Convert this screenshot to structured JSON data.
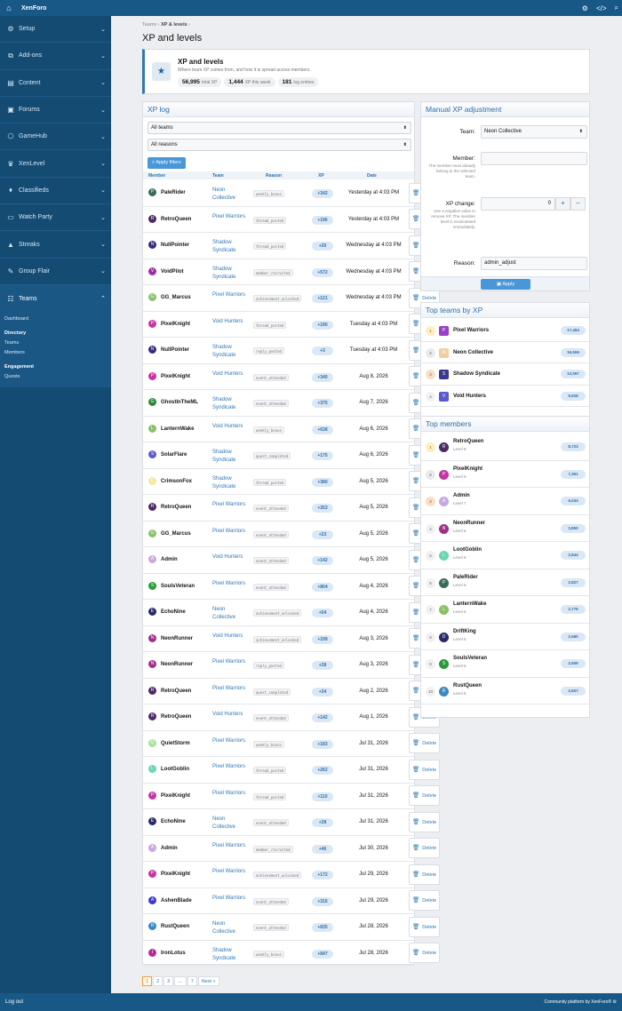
{
  "app": {
    "title": "XenForo",
    "cogs_icon": "cogs-icon",
    "code_icon": "code-icon",
    "search_icon": "search-icon"
  },
  "sidebar": {
    "items": [
      {
        "label": "Setup",
        "icon": "⚙"
      },
      {
        "label": "Add-ons",
        "icon": "⧉"
      },
      {
        "label": "Content",
        "icon": "▤"
      },
      {
        "label": "Forums",
        "icon": "▣"
      },
      {
        "label": "GameHub",
        "icon": "⎔"
      },
      {
        "label": "XenLevel",
        "icon": "♛"
      },
      {
        "label": "Classifieds",
        "icon": "⬧"
      },
      {
        "label": "Watch Party",
        "icon": "▭"
      },
      {
        "label": "Streaks",
        "icon": "▲"
      },
      {
        "label": "Group Flair",
        "icon": "✎"
      },
      {
        "label": "Teams",
        "icon": "☷"
      }
    ],
    "sub": {
      "dashboard": "Dashboard",
      "directory": "Directory",
      "teams": "Teams",
      "members": "Members",
      "engagement": "Engagement",
      "quests": "Quests"
    }
  },
  "breadcrumb": {
    "root": "Teams",
    "current": "XP & levels"
  },
  "page_title": "XP and levels",
  "hero": {
    "title": "XP and levels",
    "subtitle": "Where team XP comes from, and how it is spread across members.",
    "total_xp": "56,995",
    "total_xp_label": "total XP",
    "week_xp": "1,444",
    "week_label": "XP this week",
    "entries": "181",
    "entries_label": "log entries"
  },
  "xplog": {
    "title": "XP log",
    "team_filter": "All teams",
    "reason_filter": "All reasons",
    "apply_label": "Apply filters",
    "cols": {
      "member": "Member",
      "team": "Team",
      "reason": "Reason",
      "xp": "XP",
      "date": "Date"
    },
    "rows": [
      {
        "init": "P",
        "color": "#3a6b5c",
        "member": "PaleRider",
        "team": "Neon Collective",
        "reason": "weekly_bonus",
        "xp": "+342",
        "date": "Yesterday at 4:03 PM"
      },
      {
        "init": "R",
        "color": "#4b2a66",
        "member": "RetroQueen",
        "team": "Pixel Warriors",
        "reason": "thread_posted",
        "xp": "+196",
        "date": "Yesterday at 4:03 PM"
      },
      {
        "init": "N",
        "color": "#3a2a7a",
        "member": "NullPointer",
        "team": "Shadow Syndicate",
        "reason": "thread_posted",
        "xp": "+20",
        "date": "Wednesday at 4:03 PM"
      },
      {
        "init": "V",
        "color": "#9b2fa5",
        "member": "VoidPilot",
        "team": "Shadow Syndicate",
        "reason": "member_recruited",
        "xp": "+572",
        "date": "Wednesday at 4:03 PM"
      },
      {
        "init": "G",
        "color": "#8dc06a",
        "member": "GG_Marcus",
        "team": "Pixel Warriors",
        "reason": "achievement_unlocked",
        "xp": "+121",
        "date": "Wednesday at 4:03 PM"
      },
      {
        "init": "P",
        "color": "#c534a0",
        "member": "PixelKnight",
        "team": "Void Hunters",
        "reason": "thread_posted",
        "xp": "+190",
        "date": "Tuesday at 4:03 PM"
      },
      {
        "init": "N",
        "color": "#3a2a7a",
        "member": "NullPointer",
        "team": "Shadow Syndicate",
        "reason": "reply_posted",
        "xp": "+3",
        "date": "Tuesday at 4:03 PM"
      },
      {
        "init": "P",
        "color": "#c534a0",
        "member": "PixelKnight",
        "team": "Void Hunters",
        "reason": "event_attended",
        "xp": "+340",
        "date": "Aug 8, 2026"
      },
      {
        "init": "G",
        "color": "#2a8a3a",
        "member": "GhostInTheML",
        "team": "Shadow Syndicate",
        "reason": "event_attended",
        "xp": "+375",
        "date": "Aug 7, 2026"
      },
      {
        "init": "L",
        "color": "#8dc06a",
        "member": "LanternWake",
        "team": "Void Hunters",
        "reason": "weekly_bonus",
        "xp": "+638",
        "date": "Aug 6, 2026"
      },
      {
        "init": "S",
        "color": "#5a5ad0",
        "member": "SolarFlare",
        "team": "Shadow Syndicate",
        "reason": "quest_completed",
        "xp": "+175",
        "date": "Aug 6, 2026"
      },
      {
        "init": "C",
        "color": "#f4e79e",
        "member": "CrimsonFox",
        "team": "Shadow Syndicate",
        "reason": "thread_posted",
        "xp": "+380",
        "date": "Aug 5, 2026"
      },
      {
        "init": "R",
        "color": "#4b2a66",
        "member": "RetroQueen",
        "team": "Pixel Warriors",
        "reason": "event_attended",
        "xp": "+353",
        "date": "Aug 5, 2026"
      },
      {
        "init": "G",
        "color": "#8dc06a",
        "member": "GG_Marcus",
        "team": "Pixel Warriors",
        "reason": "event_attended",
        "xp": "+23",
        "date": "Aug 5, 2026"
      },
      {
        "init": "A",
        "color": "#c7a8e2",
        "member": "Admin",
        "team": "Void Hunters",
        "reason": "event_attended",
        "xp": "+142",
        "date": "Aug 5, 2026"
      },
      {
        "init": "S",
        "color": "#2a9a3a",
        "member": "SoulsVeteran",
        "team": "Pixel Warriors",
        "reason": "event_attended",
        "xp": "+804",
        "date": "Aug 4, 2026"
      },
      {
        "init": "E",
        "color": "#2a2a6a",
        "member": "EchoNine",
        "team": "Neon Collective",
        "reason": "achievement_unlocked",
        "xp": "+54",
        "date": "Aug 4, 2026"
      },
      {
        "init": "N",
        "color": "#a0308a",
        "member": "NeonRunner",
        "team": "Void Hunters",
        "reason": "achievement_unlocked",
        "xp": "+199",
        "date": "Aug 3, 2026"
      },
      {
        "init": "N",
        "color": "#a0308a",
        "member": "NeonRunner",
        "team": "Pixel Warriors",
        "reason": "reply_posted",
        "xp": "+28",
        "date": "Aug 3, 2026"
      },
      {
        "init": "R",
        "color": "#4b2a66",
        "member": "RetroQueen",
        "team": "Pixel Warriors",
        "reason": "quest_completed",
        "xp": "+34",
        "date": "Aug 2, 2026"
      },
      {
        "init": "R",
        "color": "#4b2a66",
        "member": "RetroQueen",
        "team": "Void Hunters",
        "reason": "event_attended",
        "xp": "+142",
        "date": "Aug 1, 2026"
      },
      {
        "init": "Q",
        "color": "#a8e29b",
        "member": "QuietStorm",
        "team": "Pixel Warriors",
        "reason": "weekly_bonus",
        "xp": "+183",
        "date": "Jul 31, 2026"
      },
      {
        "init": "L",
        "color": "#6ad6b0",
        "member": "LootGoblin",
        "team": "Pixel Warriors",
        "reason": "thread_posted",
        "xp": "+262",
        "date": "Jul 31, 2026"
      },
      {
        "init": "P",
        "color": "#c534a0",
        "member": "PixelKnight",
        "team": "Pixel Warriors",
        "reason": "thread_posted",
        "xp": "+110",
        "date": "Jul 31, 2026"
      },
      {
        "init": "E",
        "color": "#2a2a6a",
        "member": "EchoNine",
        "team": "Neon Collective",
        "reason": "event_attended",
        "xp": "+28",
        "date": "Jul 31, 2026"
      },
      {
        "init": "A",
        "color": "#c7a8e2",
        "member": "Admin",
        "team": "Pixel Warriors",
        "reason": "member_recruited",
        "xp": "+46",
        "date": "Jul 30, 2026"
      },
      {
        "init": "P",
        "color": "#c534a0",
        "member": "PixelKnight",
        "team": "Pixel Warriors",
        "reason": "achievement_unlocked",
        "xp": "+172",
        "date": "Jul 29, 2026"
      },
      {
        "init": "A",
        "color": "#3a3ad0",
        "member": "AshenBlade",
        "team": "Pixel Warriors",
        "reason": "event_attended",
        "xp": "+316",
        "date": "Jul 29, 2026"
      },
      {
        "init": "R",
        "color": "#3a8ac0",
        "member": "RustQueen",
        "team": "Neon Collective",
        "reason": "event_attended",
        "xp": "+835",
        "date": "Jul 28, 2026"
      },
      {
        "init": "I",
        "color": "#b52a9a",
        "member": "IronLotus",
        "team": "Shadow Syndicate",
        "reason": "weekly_bonus",
        "xp": "+847",
        "date": "Jul 28, 2026"
      }
    ],
    "delete_label": "Delete",
    "delete_rows": [
      0,
      1,
      2,
      3,
      4,
      5,
      6,
      7,
      8,
      9,
      10,
      11,
      12,
      13,
      14,
      15,
      16,
      17,
      18,
      19,
      20,
      21,
      22,
      23,
      24,
      25,
      26,
      27,
      28,
      29
    ]
  },
  "pager": {
    "pages": [
      "1",
      "2",
      "3",
      "&#8230;",
      "7"
    ],
    "next": "Next »"
  },
  "manual": {
    "title": "Manual XP adjustment",
    "team_label": "Team:",
    "team_value": "Neon Collective",
    "member_label": "Member:",
    "member_hint": "The member must already belong to the selected team.",
    "xp_label": "XP change:",
    "xp_hint": "Use a negative value to remove XP. The member level is recalculated immediately.",
    "xp_value": "0",
    "reason_label": "Reason:",
    "reason_value": "admin_adjust",
    "apply_label": "Apply"
  },
  "top_teams": {
    "title": "Top teams by XP",
    "rows": [
      {
        "rank": "1",
        "init": "P",
        "color": "#9a3fc8",
        "name": "Pixel Warriors",
        "xp": "17,464"
      },
      {
        "rank": "2",
        "init": "N",
        "color": "#f0d0a0",
        "name": "Neon Collective",
        "xp": "16,506"
      },
      {
        "rank": "3",
        "init": "S",
        "color": "#3a3a8a",
        "name": "Shadow Syndicate",
        "xp": "13,097"
      },
      {
        "rank": "4",
        "init": "V",
        "color": "#5a5ad0",
        "name": "Void Hunters",
        "xp": "9,928"
      }
    ]
  },
  "top_members": {
    "title": "Top members",
    "rows": [
      {
        "rank": "1",
        "init": "R",
        "color": "#4b2a66",
        "name": "RetroQueen",
        "level": "Level 8",
        "xp": "8,723"
      },
      {
        "rank": "2",
        "init": "P",
        "color": "#c534a0",
        "name": "PixelKnight",
        "level": "Level 6",
        "xp": "7,361"
      },
      {
        "rank": "3",
        "init": "A",
        "color": "#c7a8e2",
        "name": "Admin",
        "level": "Level 7",
        "xp": "6,034"
      },
      {
        "rank": "4",
        "init": "N",
        "color": "#a0308a",
        "name": "NeonRunner",
        "level": "Level 6",
        "xp": "3,850"
      },
      {
        "rank": "5",
        "init": "L",
        "color": "#6ad6b0",
        "name": "LootGoblin",
        "level": "Level 6",
        "xp": "2,844"
      },
      {
        "rank": "6",
        "init": "P",
        "color": "#3a6b5c",
        "name": "PaleRider",
        "level": "Level 6",
        "xp": "2,827"
      },
      {
        "rank": "7",
        "init": "L",
        "color": "#8dc06a",
        "name": "LanternWake",
        "level": "Level 6",
        "xp": "2,778"
      },
      {
        "rank": "8",
        "init": "D",
        "color": "#2a2a6a",
        "name": "DriftKing",
        "level": "Level 6",
        "xp": "2,680"
      },
      {
        "rank": "9",
        "init": "S",
        "color": "#2a9a3a",
        "name": "SoulsVeteran",
        "level": "Level 6",
        "xp": "2,609"
      },
      {
        "rank": "10",
        "init": "R",
        "color": "#3a8ac0",
        "name": "RustQueen",
        "level": "Level 6",
        "xp": "2,607"
      }
    ]
  },
  "footer": {
    "logout": "Log out",
    "credit": "Community platform by XenForo®"
  }
}
